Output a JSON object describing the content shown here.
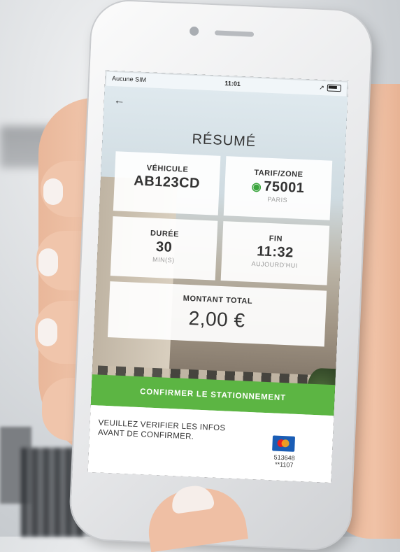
{
  "statusbar": {
    "carrier": "Aucune SIM",
    "time": "11:01",
    "location": "↗"
  },
  "screen": {
    "back_icon": "arrow-left-icon",
    "title": "RÉSUMÉ",
    "vehicle": {
      "label": "VÉHICULE",
      "value": "AB123CD"
    },
    "zone": {
      "label": "TARIF/ZONE",
      "value": "75001",
      "sub": "PARIS"
    },
    "duree": {
      "label": "DURÉE",
      "value": "30",
      "sub": "MIN(S)"
    },
    "fin": {
      "label": "FIN",
      "value": "11:32",
      "sub": "AUJOURD'HUI"
    },
    "total": {
      "label": "MONTANT TOTAL",
      "value": "2,00 €"
    },
    "confirm_label": "CONFIRMER LE STATIONNEMENT",
    "footer_message": "VEUILLEZ VERIFIER LES INFOS AVANT DE CONFIRMER.",
    "card_number_line1": "513648",
    "card_number_line2": "**1107"
  },
  "colors": {
    "accent": "#5cb543",
    "card_brand": "#1a5db5"
  }
}
